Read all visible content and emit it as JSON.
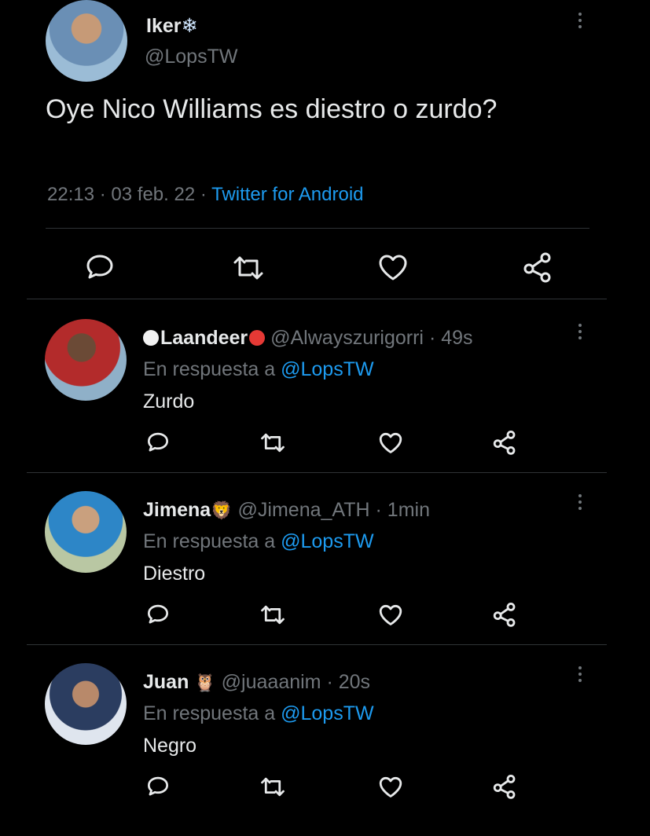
{
  "main_tweet": {
    "name": "Iker",
    "name_emoji": "❄",
    "handle": "@LopsTW",
    "text": "Oye Nico Williams es diestro o zurdo?",
    "time": "22:13",
    "separator": "·",
    "date": "03 feb. 22",
    "source": "Twitter for Android",
    "icons": [
      "reply-icon",
      "retweet-icon",
      "like-icon",
      "share-icon"
    ]
  },
  "replies": [
    {
      "name": "Laandeer",
      "handle": "@Alwayszurigorri",
      "time": "49s",
      "reply_prefix": "En respuesta a",
      "reply_to": "@LopsTW",
      "text": "Zurdo"
    },
    {
      "name": "Jimena",
      "emoji": "🦁",
      "handle": "@Jimena_ATH",
      "time": "1min",
      "reply_prefix": "En respuesta a",
      "reply_to": "@LopsTW",
      "text": "Diestro"
    },
    {
      "name": "Juan",
      "emoji": "🦉",
      "handle": "@juaaanim",
      "time": "20s",
      "reply_prefix": "En respuesta a",
      "reply_to": "@LopsTW",
      "text": "Negro"
    }
  ],
  "colors": {
    "background": "#000000",
    "text": "#e7e9ea",
    "muted": "#71767b",
    "accent": "#1d9bf0"
  }
}
